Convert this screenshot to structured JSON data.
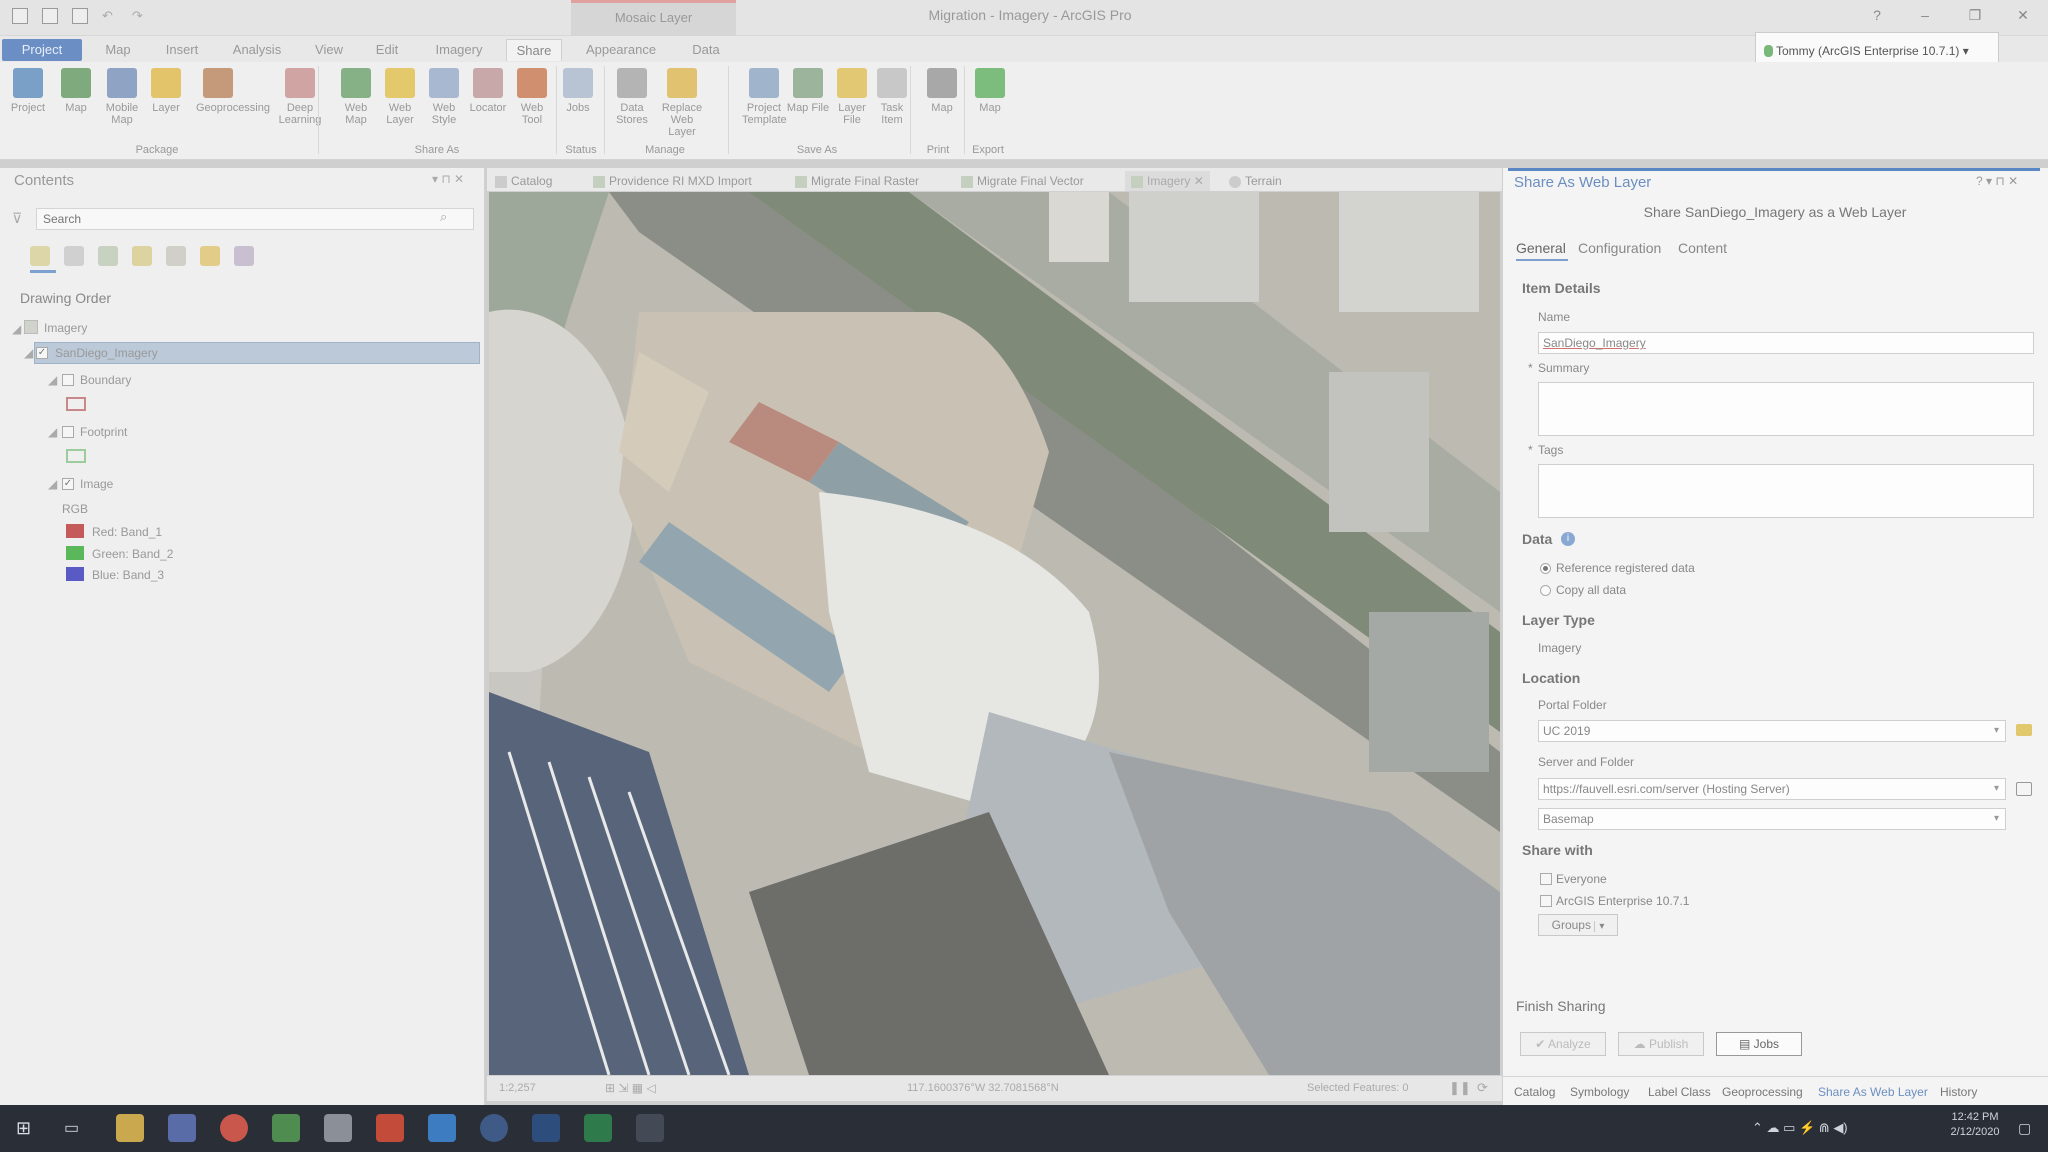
{
  "titlebar": {
    "context_tab": "Mosaic Layer",
    "app_title": "Migration - Imagery - ArcGIS Pro",
    "help": "?",
    "minimize": "–",
    "maximize": "❐",
    "close": "✕"
  },
  "ribbon_tabs": [
    "Project",
    "Map",
    "Insert",
    "Analysis",
    "View",
    "Edit",
    "Imagery",
    "Share",
    "Appearance",
    "Data"
  ],
  "user": {
    "label": "Tommy (ArcGIS Enterprise 10.7.1) ▾"
  },
  "ribbon": {
    "buttons": [
      {
        "label": "Project",
        "icon": "project-icon",
        "color": "#7aa0c8"
      },
      {
        "label": "Map",
        "icon": "map-icon",
        "color": "#7eaa7e"
      },
      {
        "label": "Mobile Map",
        "icon": "mobile-map-icon",
        "color": "#8fa4c4"
      },
      {
        "label": "Layer",
        "icon": "layer-icon",
        "color": "#e4c46a"
      },
      {
        "label": "Geoprocessing",
        "icon": "geoprocessing-icon",
        "color": "#c49a7a"
      },
      {
        "label": "Deep Learning",
        "icon": "deep-learning-icon",
        "color": "#d1a4a4"
      },
      {
        "label": "Web Map",
        "icon": "web-map-icon",
        "color": "#86b086"
      },
      {
        "label": "Web Layer",
        "icon": "web-layer-icon",
        "color": "#e4c86c"
      },
      {
        "label": "Web Style",
        "icon": "web-style-icon",
        "color": "#a8b8d0"
      },
      {
        "label": "Locator",
        "icon": "locator-icon",
        "color": "#c8a8a8"
      },
      {
        "label": "Web Tool",
        "icon": "web-tool-icon",
        "color": "#d09070"
      },
      {
        "label": "Jobs",
        "icon": "jobs-icon",
        "color": "#b8c4d4"
      },
      {
        "label": "Data Stores",
        "icon": "data-stores-icon",
        "color": "#b4b4b4"
      },
      {
        "label": "Replace Web Layer",
        "icon": "replace-web-layer-icon",
        "color": "#e0c270"
      },
      {
        "label": "Project Template",
        "icon": "project-template-icon",
        "color": "#a0b4cc"
      },
      {
        "label": "Map File",
        "icon": "map-file-icon",
        "color": "#9cb49c"
      },
      {
        "label": "Layer File",
        "icon": "layer-file-icon",
        "color": "#e2c872"
      },
      {
        "label": "Task Item",
        "icon": "task-item-icon",
        "color": "#c8c8c8"
      },
      {
        "label": "Map",
        "icon": "print-map-icon",
        "color": "#a8a8a8"
      },
      {
        "label": "Map",
        "icon": "export-map-icon",
        "color": "#7cbc7c"
      }
    ],
    "groups": [
      "Package",
      "Share As",
      "Status",
      "Manage",
      "Save As",
      "Print",
      "Export"
    ]
  },
  "contents": {
    "title": "Contents",
    "search_placeholder": "Search",
    "section": "Drawing Order",
    "tree": {
      "map": "Imagery",
      "layer": "SanDiego_Imagery",
      "boundary": "Boundary",
      "footprint": "Footprint",
      "image": "Image",
      "rgb": "RGB",
      "red": "Red:   Band_1",
      "green": "Green: Band_2",
      "blue": "Blue:  Band_3"
    }
  },
  "view_tabs": [
    "Catalog",
    "Providence RI MXD Import",
    "Migrate Final Raster",
    "Migrate Final Vector",
    "Imagery",
    "Terrain"
  ],
  "map_status": {
    "scale": "1:2,257",
    "coords": "117.1600376°W 32.7081568°N",
    "selected": "Selected Features: 0"
  },
  "share_pane": {
    "title": "Share As Web Layer",
    "subtitle": "Share SanDiego_Imagery as a Web Layer",
    "tabs": [
      "General",
      "Configuration",
      "Content"
    ],
    "item_details": "Item Details",
    "name_label": "Name",
    "name_value": "SanDiego_Imagery",
    "summary_label": "Summary",
    "tags_label": "Tags",
    "data_label": "Data",
    "data_options": [
      "Reference registered data",
      "Copy all data"
    ],
    "layer_type_label": "Layer Type",
    "layer_type_value": "Imagery",
    "location_label": "Location",
    "portal_folder_label": "Portal Folder",
    "portal_folder_value": "UC 2019",
    "server_folder_label": "Server and Folder",
    "server_value": "https://fauvell.esri.com/server (Hosting Server)",
    "server_folder_value": "Basemap",
    "share_with_label": "Share with",
    "share_options": [
      "Everyone",
      "ArcGIS Enterprise 10.7.1"
    ],
    "groups_label": "Groups",
    "finish_label": "Finish Sharing",
    "analyze": "Analyze",
    "publish": "Publish",
    "jobs": "Jobs"
  },
  "bottom_tabs": [
    "Catalog",
    "Symbology",
    "Label Class",
    "Geoprocessing",
    "Share As Web Layer",
    "History"
  ],
  "taskbar": {
    "time": "12:42 PM",
    "date": "2/12/2020"
  }
}
